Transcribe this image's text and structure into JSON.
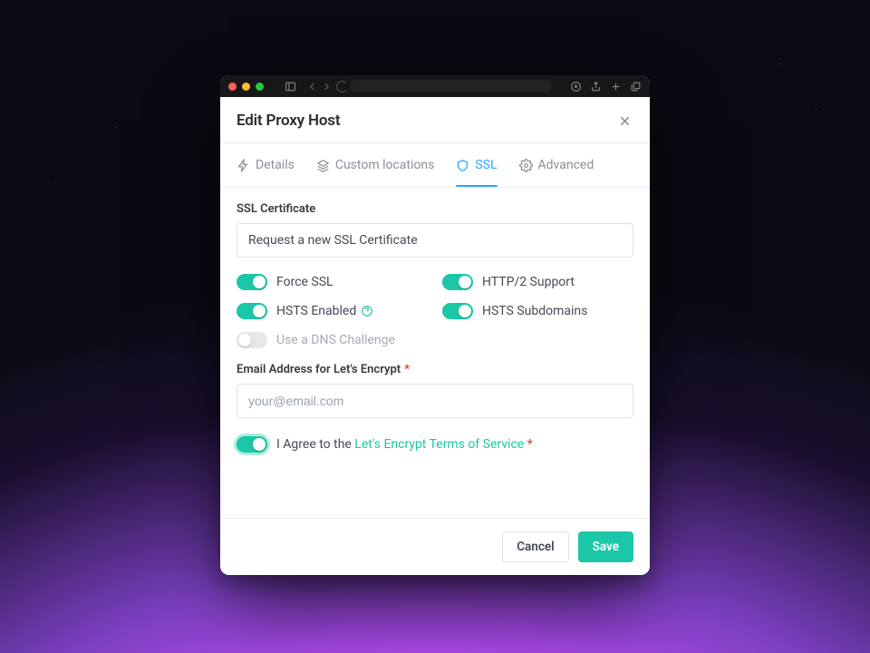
{
  "modal": {
    "title": "Edit Proxy Host"
  },
  "tabs": {
    "details": "Details",
    "custom_locations": "Custom locations",
    "ssl": "SSL",
    "advanced": "Advanced"
  },
  "ssl": {
    "certificate_label": "SSL Certificate",
    "certificate_value": "Request a new SSL Certificate",
    "toggles": {
      "force_ssl": "Force SSL",
      "http2": "HTTP/2 Support",
      "hsts": "HSTS Enabled",
      "hsts_sub": "HSTS Subdomains",
      "dns": "Use a DNS Challenge"
    },
    "email_label": "Email Address for Let's Encrypt",
    "email_placeholder": "your@email.com",
    "agree_prefix": "I Agree to the ",
    "agree_link": "Let's Encrypt Terms of Service",
    "required_mark": "*"
  },
  "footer": {
    "cancel": "Cancel",
    "save": "Save"
  }
}
